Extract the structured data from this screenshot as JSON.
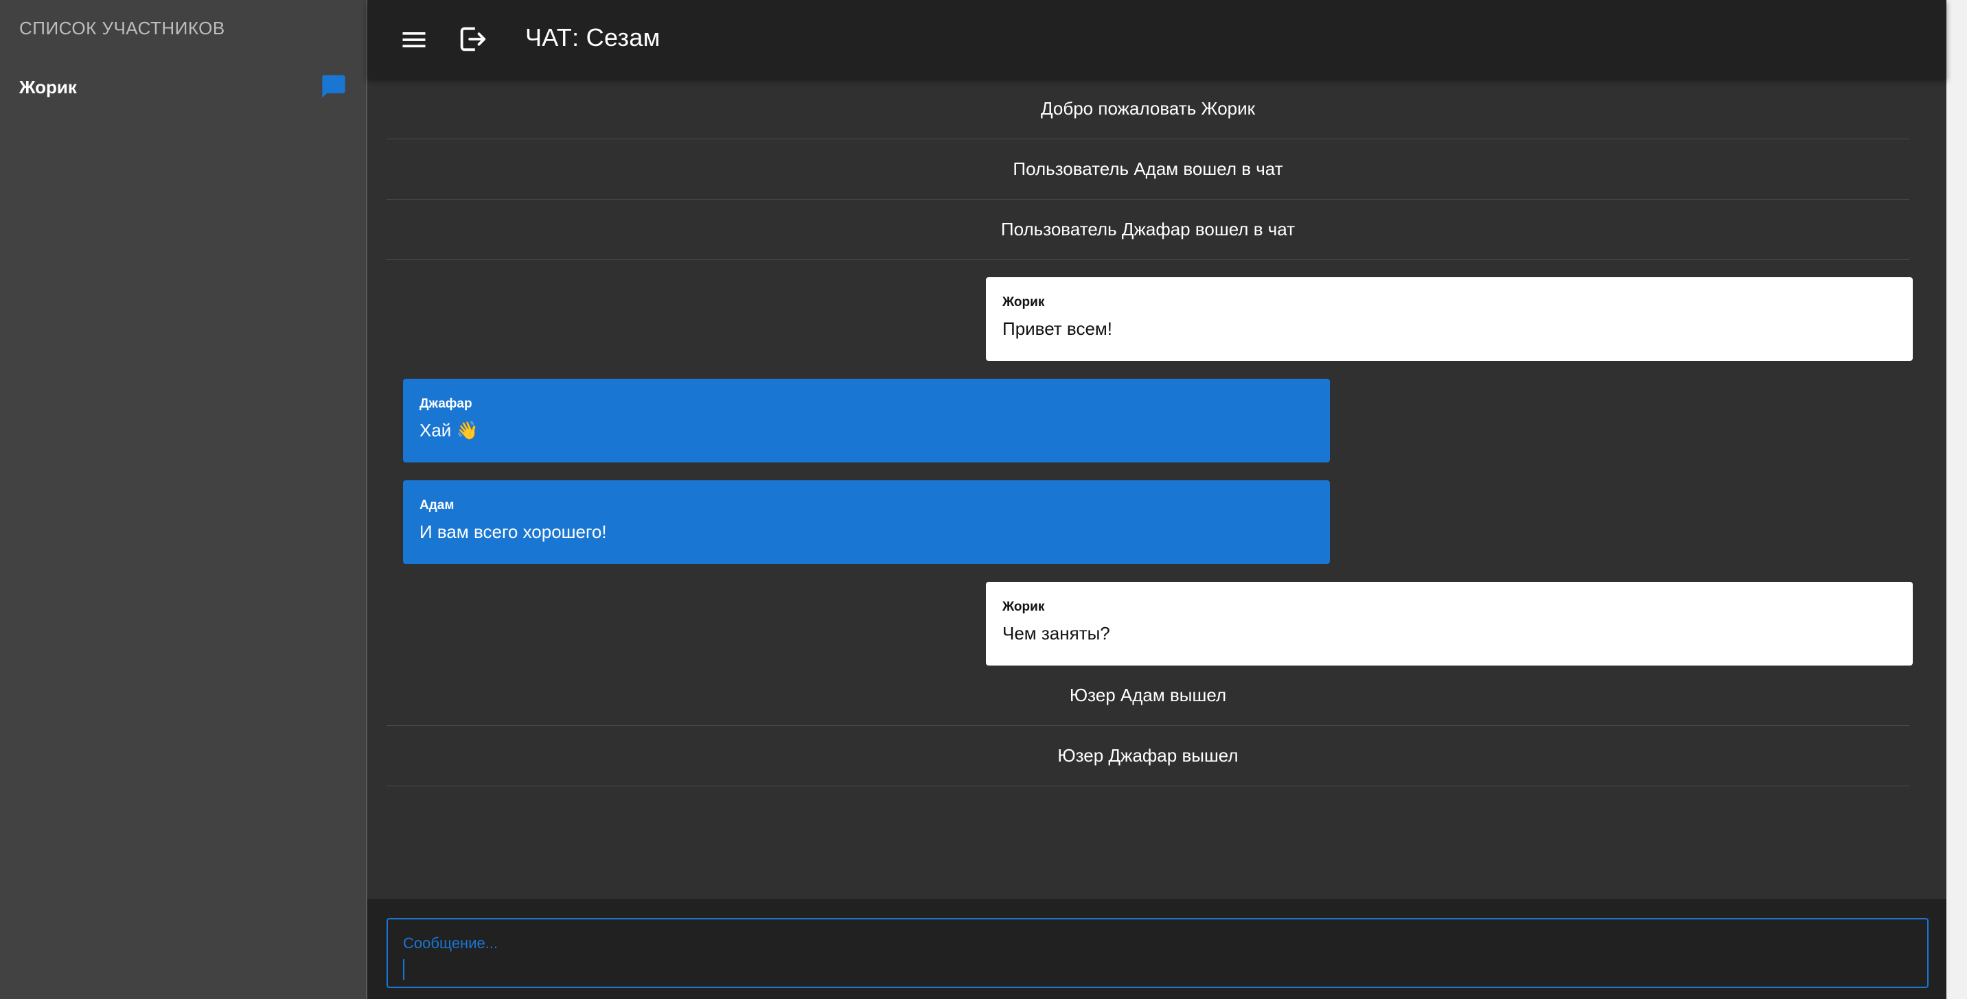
{
  "sidebar": {
    "title": "СПИСОК УЧАСТНИКОВ",
    "members": [
      {
        "name": "Жорик",
        "icon": "chat-bubble-icon"
      }
    ]
  },
  "header": {
    "menu_icon": "menu-icon",
    "logout_icon": "logout-icon",
    "title": "ЧАТ: Сезам"
  },
  "messages": [
    {
      "type": "system",
      "text": "Добро пожаловать Жорик"
    },
    {
      "type": "system",
      "text": "Пользователь Адам вошел в чат"
    },
    {
      "type": "system",
      "text": "Пользователь Джафар вошел в чат"
    },
    {
      "type": "own",
      "author": "Жорик",
      "text": "Привет всем!"
    },
    {
      "type": "other",
      "author": "Джафар",
      "text": "Хай 👋"
    },
    {
      "type": "other",
      "author": "Адам",
      "text": "И вам всего хорошего!"
    },
    {
      "type": "own",
      "author": "Жорик",
      "text": "Чем заняты?"
    },
    {
      "type": "system",
      "text": "Юзер Адам вышел"
    },
    {
      "type": "system",
      "text": "Юзер Джафар вышел"
    }
  ],
  "composer": {
    "label": "Сообщение...",
    "value": ""
  },
  "colors": {
    "accent": "#1976d2",
    "sidebar_bg": "#424242",
    "main_bg": "#303030",
    "topbar_bg": "#212121"
  }
}
